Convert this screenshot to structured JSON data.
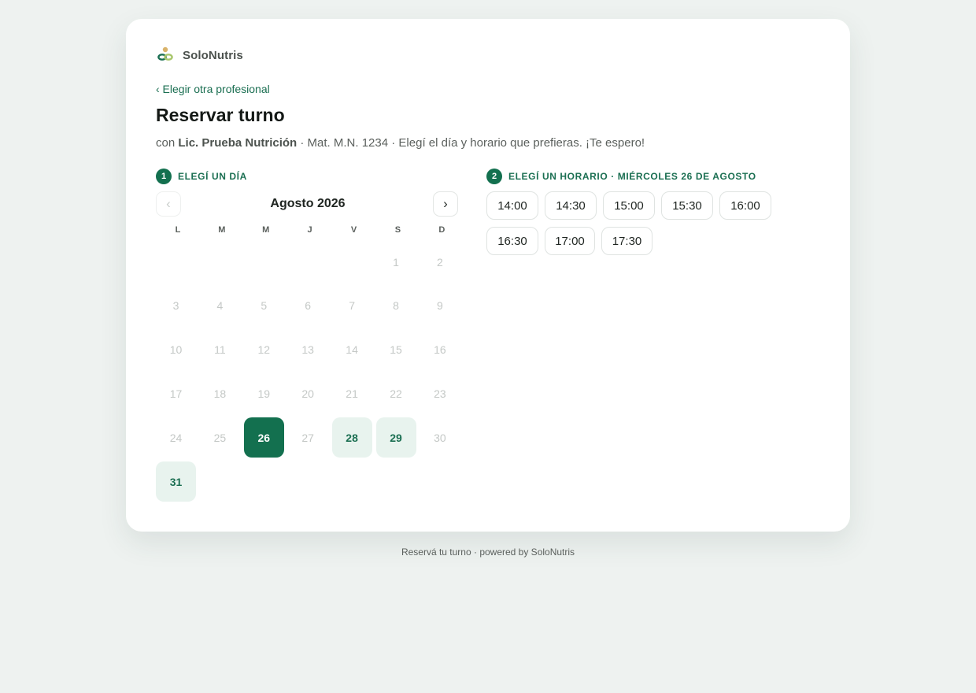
{
  "brand": {
    "name": "SoloNutris",
    "logo_icon": "solonutris-logo-icon",
    "accent": "#13704f"
  },
  "back_link": "‹ Elegir otra profesional",
  "title": "Reservar turno",
  "subtitle": {
    "prefix": "con ",
    "professional": "Lic. Prueba Nutrición",
    "suffix": " · Mat. M.N. 1234 · Elegí el día y horario que prefieras. ¡Te espero!"
  },
  "step1": {
    "number": "1",
    "label": "ELEGÍ UN DÍA"
  },
  "step2": {
    "number": "2",
    "label": "ELEGÍ UN HORARIO · MIÉRCOLES 26 DE AGOSTO"
  },
  "calendar": {
    "month_label": "Agosto 2026",
    "prev_icon": "‹",
    "next_icon": "›",
    "weekdays": [
      "L",
      "M",
      "M",
      "J",
      "V",
      "S",
      "D"
    ],
    "days": [
      {
        "n": "1",
        "state": "disabled"
      },
      {
        "n": "2",
        "state": "disabled"
      },
      {
        "n": "3",
        "state": "disabled"
      },
      {
        "n": "4",
        "state": "disabled"
      },
      {
        "n": "5",
        "state": "disabled"
      },
      {
        "n": "6",
        "state": "disabled"
      },
      {
        "n": "7",
        "state": "disabled"
      },
      {
        "n": "8",
        "state": "disabled"
      },
      {
        "n": "9",
        "state": "disabled"
      },
      {
        "n": "10",
        "state": "disabled"
      },
      {
        "n": "11",
        "state": "disabled"
      },
      {
        "n": "12",
        "state": "disabled"
      },
      {
        "n": "13",
        "state": "disabled"
      },
      {
        "n": "14",
        "state": "disabled"
      },
      {
        "n": "15",
        "state": "disabled"
      },
      {
        "n": "16",
        "state": "disabled"
      },
      {
        "n": "17",
        "state": "disabled"
      },
      {
        "n": "18",
        "state": "disabled"
      },
      {
        "n": "19",
        "state": "disabled"
      },
      {
        "n": "20",
        "state": "disabled"
      },
      {
        "n": "21",
        "state": "disabled"
      },
      {
        "n": "22",
        "state": "disabled"
      },
      {
        "n": "23",
        "state": "disabled"
      },
      {
        "n": "24",
        "state": "disabled"
      },
      {
        "n": "25",
        "state": "disabled"
      },
      {
        "n": "26",
        "state": "selected"
      },
      {
        "n": "27",
        "state": "disabled"
      },
      {
        "n": "28",
        "state": "available"
      },
      {
        "n": "29",
        "state": "available"
      },
      {
        "n": "30",
        "state": "disabled"
      },
      {
        "n": "31",
        "state": "available"
      }
    ]
  },
  "time_slots": [
    "14:00",
    "14:30",
    "15:00",
    "15:30",
    "16:00",
    "16:30",
    "17:00",
    "17:30"
  ],
  "footer": "Reservá tu turno · powered by SoloNutris"
}
